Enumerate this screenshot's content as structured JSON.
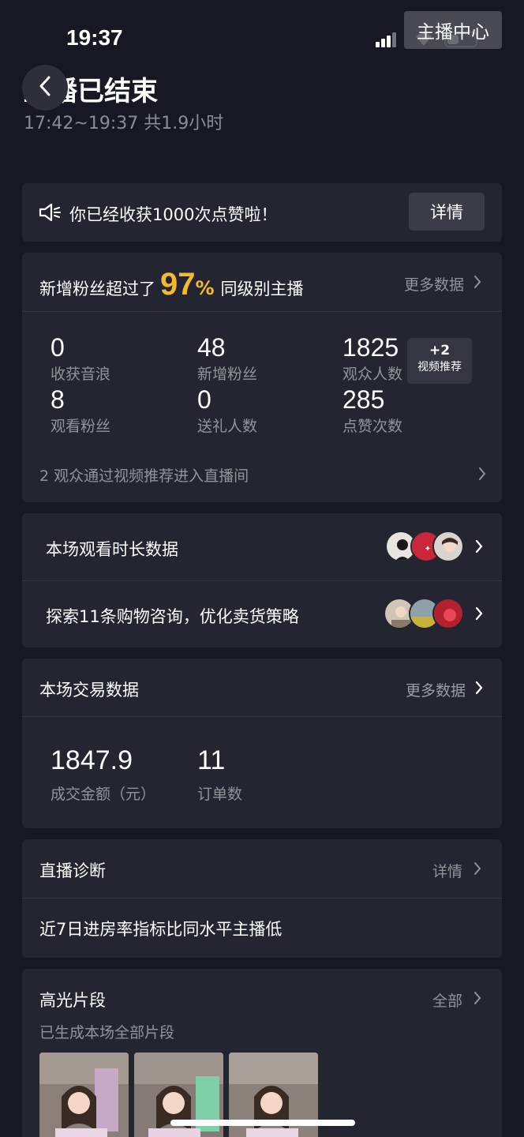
{
  "status_bar": {
    "time": "19:37"
  },
  "header": {
    "anchor_center_label": "主播中心",
    "title": "直播已结束",
    "time_range": "17:42~19:37 共1.9小时"
  },
  "notice": {
    "text": "你已经收获1000次点赞啦！",
    "button_label": "详情"
  },
  "fans_card": {
    "prefix": "新增粉丝超过了",
    "percent": "97",
    "percent_unit": "%",
    "suffix": "同级别主播",
    "more_label": "更多数据",
    "metrics": [
      {
        "value": "0",
        "label": "收获音浪"
      },
      {
        "value": "48",
        "label": "新增粉丝"
      },
      {
        "value": "1825",
        "label": "观众人数"
      },
      {
        "value": "8",
        "label": "观看粉丝"
      },
      {
        "value": "0",
        "label": "送礼人数"
      },
      {
        "value": "285",
        "label": "点赞次数"
      }
    ],
    "video_badge": {
      "count": "+2",
      "label": "视频推荐"
    },
    "footer": "2 观众通过视频推荐进入直播间"
  },
  "watch_duration": {
    "label": "本场观看时长数据"
  },
  "shopping": {
    "label": "探索11条购物咨询，优化卖货策略"
  },
  "trade_card": {
    "title": "本场交易数据",
    "more_label": "更多数据",
    "amount_value": "1847.9",
    "amount_label": "成交金额（元）",
    "orders_value": "11",
    "orders_label": "订单数"
  },
  "diagnosis": {
    "title": "直播诊断",
    "detail_label": "详情",
    "text": "近7日进房率指标比同水平主播低"
  },
  "highlights": {
    "title": "高光片段",
    "all_label": "全部",
    "subtitle": "已生成本场全部片段"
  },
  "colors": {
    "background": "#161823",
    "card": "#232530",
    "accent_percent": "#f5b92e",
    "text_dim": "rgba(255,255,255,0.5)"
  }
}
